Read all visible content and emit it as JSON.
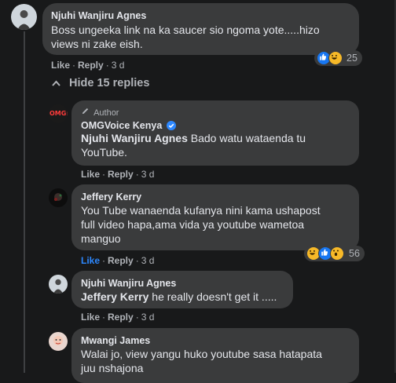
{
  "comments": [
    {
      "author": "Njuhi Wanjiru Agnes",
      "text_line1": "Boss ungeeka link na ka saucer sio ngoma yote.....hizo",
      "text_line2": "views ni zake eish.",
      "actions": {
        "like": "Like",
        "reply": "Reply",
        "time": "3 d"
      },
      "reactions": {
        "icons": [
          "like-icon",
          "laugh-icon"
        ],
        "count": "25"
      }
    }
  ],
  "replies_toggle": {
    "label": "Hide 15 replies",
    "icon": "chevron-up-icon"
  },
  "replies": [
    {
      "badge": "Author",
      "author": "OMGVoice Kenya",
      "verified_icon": "verified-icon",
      "mention": "Njuhi Wanjiru Agnes",
      "text_line1_rest": " Bado watu wataenda tu",
      "text_line2": "YouTube.",
      "avatar_text": "OMG!",
      "actions": {
        "like": "Like",
        "reply": "Reply",
        "time": "3 d"
      }
    },
    {
      "author": "Jeffery Kerry",
      "text_line1": "You Tube wanaenda kufanya nini kama ushapost",
      "text_line2": "full video hapa,ama vida ya youtube wametoa",
      "text_line3": "manguo",
      "actions": {
        "like": "Like",
        "reply": "Reply",
        "time": "3 d"
      },
      "reactions": {
        "icons": [
          "laugh-icon",
          "like-icon",
          "wow-icon"
        ],
        "count": "56"
      }
    },
    {
      "author": "Njuhi Wanjiru Agnes",
      "mention": "Jeffery Kerry",
      "text_line1_rest": " he really doesn't get it .....",
      "actions": {
        "like": "Like",
        "reply": "Reply",
        "time": "3 d"
      }
    },
    {
      "author": "Mwangi James",
      "text_line1": "Walai jo, view yangu huko youtube sasa hatapata",
      "text_line2": "juu nshajona"
    }
  ],
  "colors": {
    "background": "#18191a",
    "bubble": "#3a3b3c",
    "accent": "#2d88ff",
    "muted": "#b0b3b8"
  }
}
